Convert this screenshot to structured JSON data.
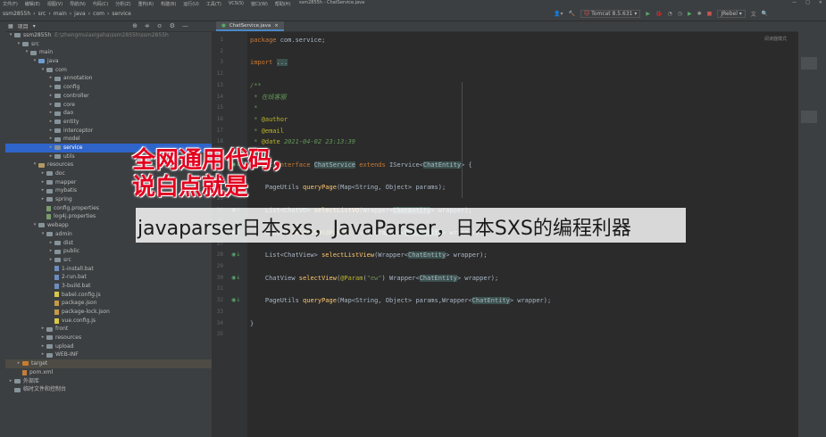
{
  "menubar": {
    "items": [
      "文件(F)",
      "编辑(E)",
      "视图(V)",
      "导航(N)",
      "代码(C)",
      "分析(Z)",
      "重构(R)",
      "构建(B)",
      "运行(U)",
      "工具(T)",
      "VCS(S)",
      "窗口(W)",
      "帮助(H)"
    ],
    "window_title": "ssm2855h - ChatService.java"
  },
  "breadcrumb": [
    "ssm2855h",
    "src",
    "main",
    "java",
    "com",
    "service"
  ],
  "toolbar": {
    "run_config": "Tomcat 8.5.631",
    "rebel": "JRebel",
    "icons": [
      "user-icon",
      "hammer-icon",
      "run-icon",
      "debug-icon",
      "coverage-icon",
      "profile-icon",
      "stop-icon",
      "search-icon"
    ]
  },
  "project_panel": {
    "title": "项目",
    "items": [
      {
        "indent": 0,
        "arrow": "▾",
        "icon": "folder",
        "label": "ssm2855h",
        "path": "E:\\zhengmuiaxigaha\\ssm2855h\\ssm2855h"
      },
      {
        "indent": 1,
        "arrow": "▾",
        "icon": "folder",
        "label": "src"
      },
      {
        "indent": 2,
        "arrow": "▾",
        "icon": "folder",
        "label": "main"
      },
      {
        "indent": 3,
        "arrow": "▾",
        "icon": "src",
        "label": "java"
      },
      {
        "indent": 4,
        "arrow": "▾",
        "icon": "folder",
        "label": "com"
      },
      {
        "indent": 5,
        "arrow": "▸",
        "icon": "folder",
        "label": "annotation"
      },
      {
        "indent": 5,
        "arrow": "▸",
        "icon": "folder",
        "label": "config"
      },
      {
        "indent": 5,
        "arrow": "▸",
        "icon": "folder",
        "label": "controller"
      },
      {
        "indent": 5,
        "arrow": "▸",
        "icon": "folder",
        "label": "core"
      },
      {
        "indent": 5,
        "arrow": "▸",
        "icon": "folder",
        "label": "dao"
      },
      {
        "indent": 5,
        "arrow": "▸",
        "icon": "folder",
        "label": "entity"
      },
      {
        "indent": 5,
        "arrow": "▸",
        "icon": "folder",
        "label": "interceptor"
      },
      {
        "indent": 5,
        "arrow": "▸",
        "icon": "folder",
        "label": "model"
      },
      {
        "indent": 5,
        "arrow": "▸",
        "icon": "folder",
        "label": "service",
        "selected": true
      },
      {
        "indent": 5,
        "arrow": "▸",
        "icon": "folder",
        "label": "utils"
      },
      {
        "indent": 3,
        "arrow": "▾",
        "icon": "res",
        "label": "resources"
      },
      {
        "indent": 4,
        "arrow": "▸",
        "icon": "folder",
        "label": "doc"
      },
      {
        "indent": 4,
        "arrow": "▸",
        "icon": "folder",
        "label": "mapper"
      },
      {
        "indent": 4,
        "arrow": "▸",
        "icon": "folder",
        "label": "mybatis"
      },
      {
        "indent": 4,
        "arrow": "▸",
        "icon": "folder",
        "label": "spring"
      },
      {
        "indent": 4,
        "arrow": "",
        "icon": "props",
        "label": "config.properties"
      },
      {
        "indent": 4,
        "arrow": "",
        "icon": "props",
        "label": "log4j.properties"
      },
      {
        "indent": 3,
        "arrow": "▾",
        "icon": "folder",
        "label": "webapp"
      },
      {
        "indent": 4,
        "arrow": "▾",
        "icon": "folder",
        "label": "admin"
      },
      {
        "indent": 5,
        "arrow": "▸",
        "icon": "folder",
        "label": "dist"
      },
      {
        "indent": 5,
        "arrow": "▸",
        "icon": "folder",
        "label": "public"
      },
      {
        "indent": 5,
        "arrow": "▸",
        "icon": "folder",
        "label": "src"
      },
      {
        "indent": 5,
        "arrow": "",
        "icon": "bat",
        "label": "1-install.bat"
      },
      {
        "indent": 5,
        "arrow": "",
        "icon": "bat",
        "label": "2-run.bat"
      },
      {
        "indent": 5,
        "arrow": "",
        "icon": "bat",
        "label": "3-build.bat"
      },
      {
        "indent": 5,
        "arrow": "",
        "icon": "js",
        "label": "babel.config.js"
      },
      {
        "indent": 5,
        "arrow": "",
        "icon": "json",
        "label": "package.json"
      },
      {
        "indent": 5,
        "arrow": "",
        "icon": "json",
        "label": "package-lock.json"
      },
      {
        "indent": 5,
        "arrow": "",
        "icon": "js",
        "label": "vue.config.js"
      },
      {
        "indent": 4,
        "arrow": "▸",
        "icon": "folder",
        "label": "front"
      },
      {
        "indent": 4,
        "arrow": "▸",
        "icon": "folder",
        "label": "resources"
      },
      {
        "indent": 4,
        "arrow": "▸",
        "icon": "folder",
        "label": "upload"
      },
      {
        "indent": 4,
        "arrow": "▸",
        "icon": "folder",
        "label": "WEB-INF"
      },
      {
        "indent": 1,
        "arrow": "▸",
        "icon": "orange",
        "label": "target",
        "target": true
      },
      {
        "indent": 1,
        "arrow": "",
        "icon": "xml",
        "label": "pom.xml"
      },
      {
        "indent": 0,
        "arrow": "▸",
        "icon": "folder",
        "label": "外部库"
      },
      {
        "indent": 0,
        "arrow": "",
        "icon": "folder",
        "label": "临时文件和控制台"
      }
    ]
  },
  "editor": {
    "tab_label": "ChatService.java",
    "right_hint": "阅读器模式",
    "lines": [
      {
        "n": "1",
        "segs": [
          [
            "kw",
            "package "
          ],
          [
            "",
            "com.service;"
          ]
        ]
      },
      {
        "n": "2",
        "segs": []
      },
      {
        "n": "3",
        "segs": [
          [
            "kw",
            "import "
          ],
          [
            "hl",
            "..."
          ]
        ]
      },
      {
        "n": "12",
        "segs": []
      },
      {
        "n": "13",
        "segs": [
          [
            "cmt",
            "/**"
          ]
        ]
      },
      {
        "n": "14",
        "segs": [
          [
            "cmt",
            " * 在线客服"
          ]
        ]
      },
      {
        "n": "15",
        "segs": [
          [
            "cmt",
            " *"
          ]
        ]
      },
      {
        "n": "16",
        "segs": [
          [
            "cmt",
            " * "
          ],
          [
            "ann",
            "@author"
          ]
        ]
      },
      {
        "n": "17",
        "segs": [
          [
            "cmt",
            " * "
          ],
          [
            "ann",
            "@email"
          ]
        ]
      },
      {
        "n": "18",
        "segs": [
          [
            "cmt",
            " * "
          ],
          [
            "ann",
            "@date"
          ],
          [
            "cmt",
            " 2021-04-02 23:13:39"
          ]
        ]
      },
      {
        "n": "19",
        "segs": [
          [
            "cmt",
            " */"
          ]
        ]
      },
      {
        "n": "20",
        "segs": [
          [
            "kw",
            "public interface "
          ],
          [
            "hl",
            "ChatService"
          ],
          [
            "",
            ""
          ],
          [
            "kw",
            " extends "
          ],
          [
            "",
            "IService<"
          ],
          [
            "hl",
            "ChatEntity"
          ],
          [
            "",
            "> {"
          ]
        ]
      },
      {
        "n": "21",
        "segs": []
      },
      {
        "n": "22",
        "segs": [
          [
            "",
            "    PageUtils "
          ],
          [
            "fn",
            "queryPage"
          ],
          [
            "",
            "(Map<String, Object> params);"
          ]
        ]
      },
      {
        "n": "23",
        "segs": []
      },
      {
        "n": "24",
        "segs": [
          [
            "",
            "    List<ChatVO> "
          ],
          [
            "fn",
            "selectListVO"
          ],
          [
            "",
            "(Wrapper<"
          ],
          [
            "hl",
            "ChatEntity"
          ],
          [
            "",
            "> wrapper);"
          ]
        ]
      },
      {
        "n": "25",
        "segs": []
      },
      {
        "n": "26",
        "segs": [
          [
            "",
            "    ChatVO "
          ],
          [
            "fn",
            "selectVO"
          ],
          [
            "",
            "("
          ],
          [
            "ann",
            "@Param"
          ],
          [
            "",
            "("
          ],
          [
            "str",
            "\"ew\""
          ],
          [
            "",
            ") Wrapper<"
          ],
          [
            "hl",
            "ChatEntity"
          ],
          [
            "",
            "> wrapper);"
          ]
        ]
      },
      {
        "n": "27",
        "segs": []
      },
      {
        "n": "28",
        "segs": [
          [
            "",
            "    List<ChatView> "
          ],
          [
            "fn",
            "selectListView"
          ],
          [
            "",
            "(Wrapper<"
          ],
          [
            "hl",
            "ChatEntity"
          ],
          [
            "",
            "> wrapper);"
          ]
        ]
      },
      {
        "n": "29",
        "segs": []
      },
      {
        "n": "30",
        "segs": [
          [
            "",
            "    ChatView "
          ],
          [
            "fn",
            "selectView"
          ],
          [
            "",
            "("
          ],
          [
            "ann",
            "@Param"
          ],
          [
            "",
            "("
          ],
          [
            "str",
            "\"ew\""
          ],
          [
            "",
            ") Wrapper<"
          ],
          [
            "hl",
            "ChatEntity"
          ],
          [
            "",
            "> wrapper);"
          ]
        ]
      },
      {
        "n": "31",
        "segs": []
      },
      {
        "n": "32",
        "segs": [
          [
            "",
            "    PageUtils "
          ],
          [
            "fn",
            "queryPage"
          ],
          [
            "",
            "(Map<String, Object> params,Wrapper<"
          ],
          [
            "hl",
            "ChatEntity"
          ],
          [
            "",
            "> wrapper);"
          ]
        ]
      },
      {
        "n": "33",
        "segs": []
      },
      {
        "n": "34",
        "segs": [
          [
            "",
            "}"
          ]
        ]
      },
      {
        "n": "35",
        "segs": []
      }
    ]
  },
  "overlay": {
    "red_line1": "全网通用代码，",
    "red_line2": "说白点就是",
    "caption": "javaparser日本sxs，JavaParser，日本SXS的编程利器"
  }
}
